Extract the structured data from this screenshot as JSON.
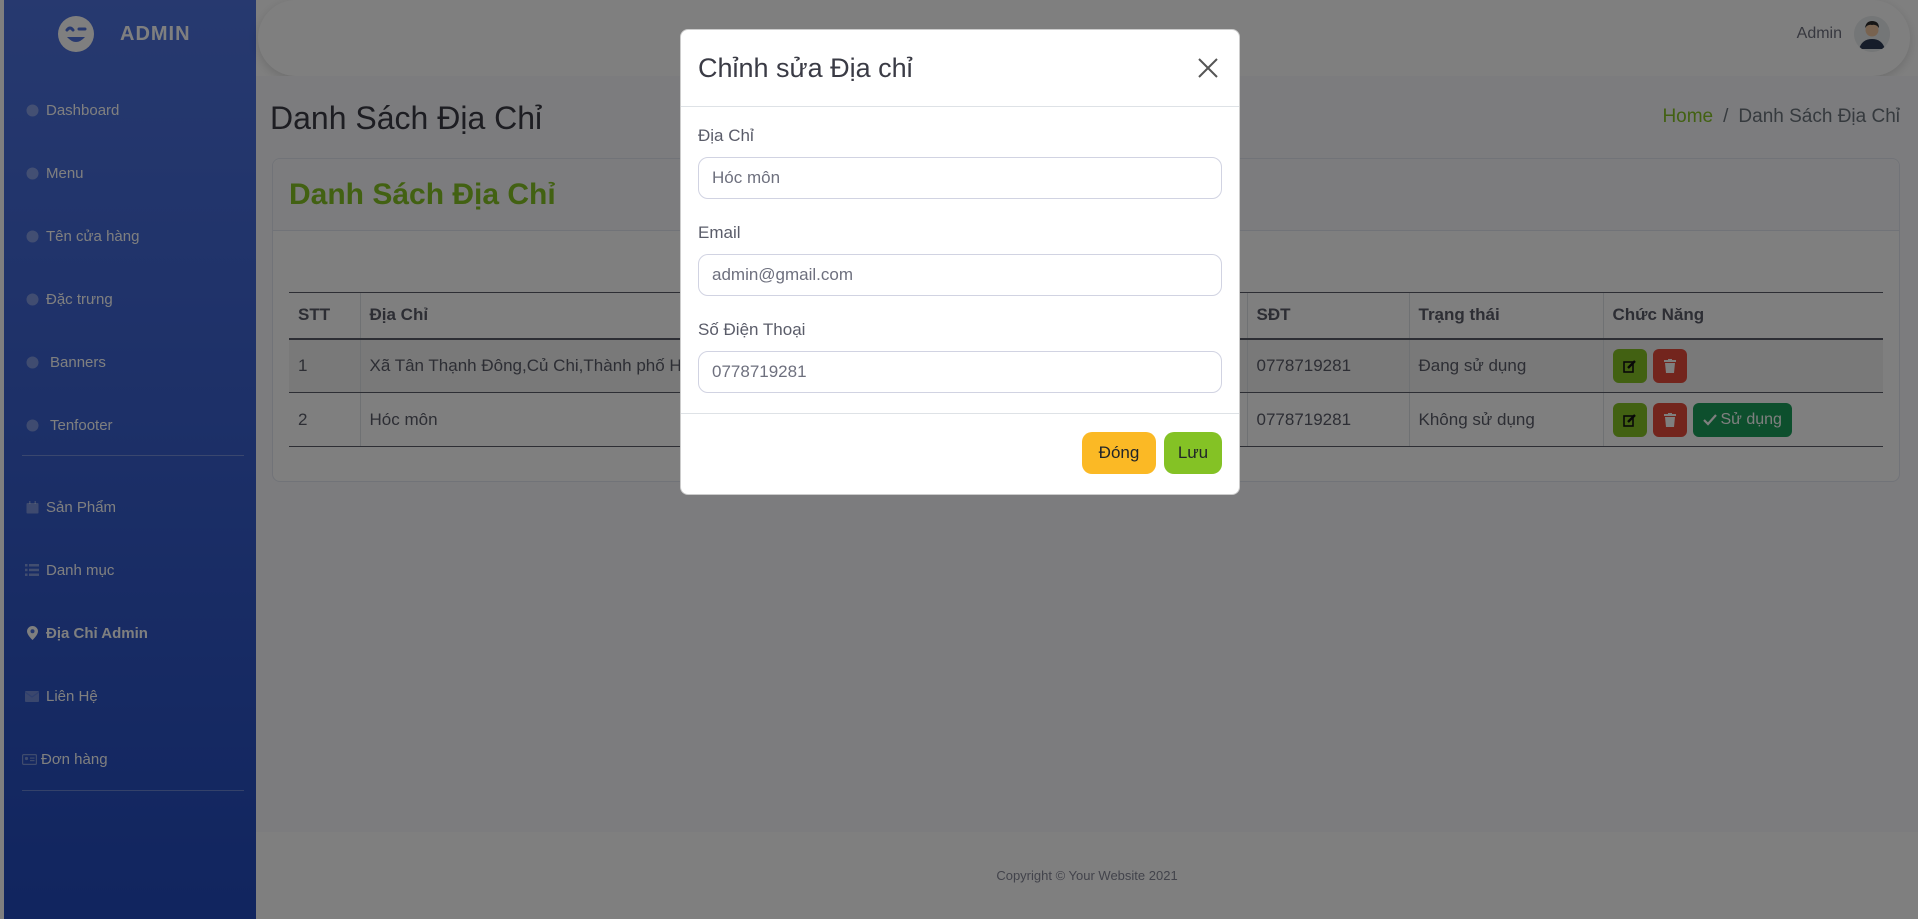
{
  "colors": {
    "sidebar": "#4e73df",
    "accent": "#84c225",
    "danger": "#e74a3b",
    "success": "#1a9e5a",
    "warning": "#fbb925"
  },
  "sidebar": {
    "brand": "ADMIN",
    "items": [
      {
        "label": "Dashboard",
        "icon": "circle-icon"
      },
      {
        "label": "Menu",
        "icon": "circle-icon"
      },
      {
        "label": "Tên cửa hàng",
        "icon": "circle-icon"
      },
      {
        "label": "Đặc trưng",
        "icon": "circle-icon"
      },
      {
        "label": "Banners",
        "icon": "circle-icon"
      },
      {
        "label": "Tenfooter",
        "icon": "circle-icon"
      },
      {
        "label": "Sản Phẩm",
        "icon": "calendar-icon"
      },
      {
        "label": "Danh mục",
        "icon": "list-icon"
      },
      {
        "label": "Địa Chỉ Admin",
        "icon": "map-marker-icon"
      },
      {
        "label": "Liên Hệ",
        "icon": "envelope-icon"
      },
      {
        "label": "Đơn hàng",
        "icon": "id-card-icon"
      }
    ]
  },
  "topbar": {
    "user_name": "Admin"
  },
  "page": {
    "title": "Danh Sách Địa Chỉ",
    "breadcrumb_home": "Home",
    "breadcrumb_sep": "/",
    "breadcrumb_current": "Danh Sách Địa Chỉ",
    "card_title": "Danh Sách Địa Chỉ"
  },
  "table": {
    "headers": {
      "stt": "STT",
      "address": "Địa Chỉ",
      "phone": "SĐT",
      "status": "Trạng thái",
      "actions": "Chức Năng"
    },
    "rows": [
      {
        "stt": "1",
        "address": "Xã Tân Thạnh Đông,Củ Chi,Thành phố H",
        "phone": "0778719281",
        "status": "Đang sử dụng"
      },
      {
        "stt": "2",
        "address": "Hóc môn",
        "phone": "0778719281",
        "status": "Không sử dụng",
        "use_label": "Sử dụng"
      }
    ]
  },
  "modal": {
    "title": "Chỉnh sửa Địa chỉ",
    "address_label": "Địa Chỉ",
    "address_value": "Hóc môn",
    "email_label": "Email",
    "email_value": "admin@gmail.com",
    "phone_label": "Số Điện Thoại",
    "phone_value": "0778719281",
    "close_label": "Đóng",
    "save_label": "Lưu"
  },
  "footer": {
    "copyright": "Copyright © Your Website 2021"
  }
}
